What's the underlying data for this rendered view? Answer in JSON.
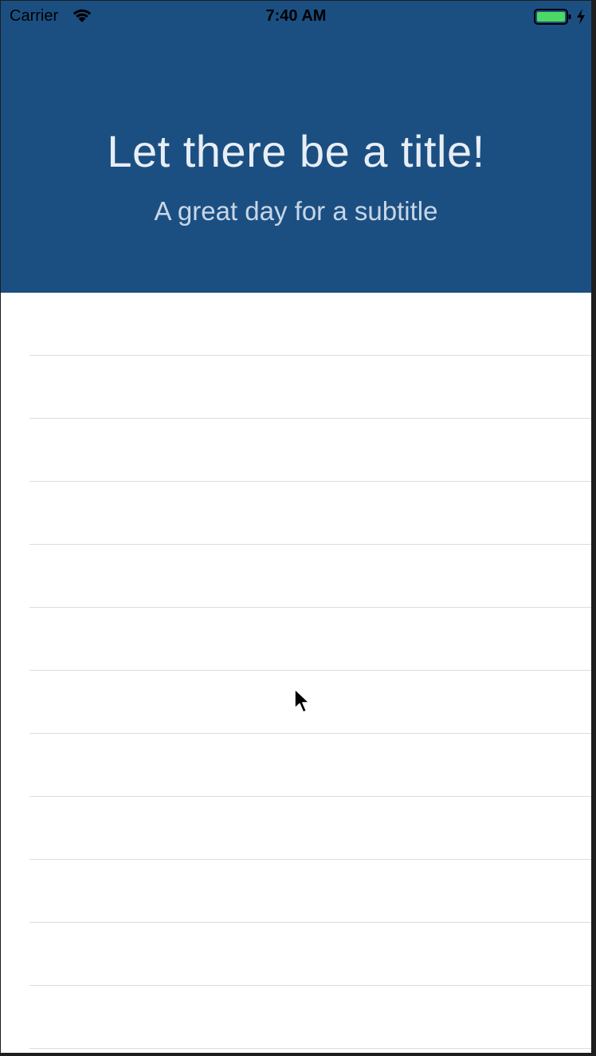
{
  "status_bar": {
    "carrier": "Carrier",
    "time": "7:40 AM",
    "icons": [
      "wifi-icon",
      "battery-icon",
      "charging-icon"
    ],
    "battery_color": "#4cd964"
  },
  "header": {
    "title": "Let there be a title!",
    "subtitle": "A great day for a subtitle",
    "background": "#1b4f82"
  },
  "table": {
    "rows": [
      "",
      "",
      "",
      "",
      "",
      "",
      "",
      "",
      "",
      "",
      "",
      "",
      ""
    ]
  },
  "cursor": "arrow-cursor-icon"
}
